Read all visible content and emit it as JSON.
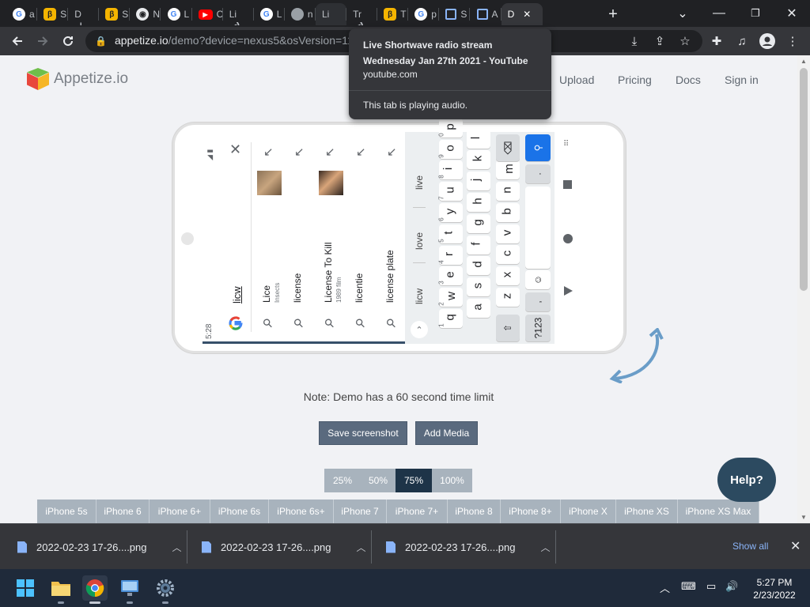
{
  "browser": {
    "tabs": [
      {
        "icon": "google-icon",
        "label": "a"
      },
      {
        "icon": "orange-icon",
        "label": "S"
      },
      {
        "icon": "download-icon",
        "label": "D"
      },
      {
        "icon": "orange-icon",
        "label": "S"
      },
      {
        "icon": "github-icon",
        "label": "N"
      },
      {
        "icon": "google-icon",
        "label": "L"
      },
      {
        "icon": "youtube-icon",
        "label": "C"
      },
      {
        "icon": "audio-icon",
        "label": "Li"
      },
      {
        "icon": "google-icon",
        "label": "L"
      },
      {
        "icon": "globe-icon",
        "label": "n"
      },
      {
        "icon": "none",
        "label": "Li"
      },
      {
        "icon": "audio-icon",
        "label": "Tr"
      },
      {
        "icon": "orange-icon",
        "label": "T"
      },
      {
        "icon": "google-icon",
        "label": "p"
      },
      {
        "icon": "appetize-icon",
        "label": "S"
      },
      {
        "icon": "appetize-icon",
        "label": "A"
      },
      {
        "icon": "none",
        "label": "D",
        "active": true
      }
    ],
    "new_tab": "+",
    "url_host": "appetize.io",
    "url_path": "/demo?device=nexus5&osVersion=11",
    "window_controls": {
      "minimize": "—",
      "restore": "❐",
      "close": "✕",
      "tab_search": "⌄"
    }
  },
  "tooltip": {
    "title_line1": "Live Shortwave radio stream",
    "title_line2": "Wednesday Jan 27th 2021 - YouTube",
    "domain": "youtube.com",
    "status": "This tab is playing audio."
  },
  "site": {
    "logo_text": "Appetize.io",
    "nav": [
      "Upload",
      "Pricing",
      "Docs",
      "Sign in"
    ],
    "note": "Note: Demo has a 60 second time limit",
    "save_screenshot": "Save screenshot",
    "add_media": "Add Media",
    "zoom": [
      {
        "label": "25%",
        "selected": false
      },
      {
        "label": "50%",
        "selected": false
      },
      {
        "label": "75%",
        "selected": true
      },
      {
        "label": "100%",
        "selected": false
      }
    ],
    "devices": [
      "iPhone 5s",
      "iPhone 6",
      "iPhone 6+",
      "iPhone 6s",
      "iPhone 6s+",
      "iPhone 7",
      "iPhone 7+",
      "iPhone 8",
      "iPhone 8+",
      "iPhone X",
      "iPhone XS",
      "iPhone XS Max"
    ],
    "help": "Help?"
  },
  "emulator": {
    "status_time": "5:28",
    "search_query": "licw",
    "suggestions": [
      {
        "title": "Lice",
        "subtitle": "Insects",
        "has_image": true
      },
      {
        "title": "license",
        "subtitle": "",
        "has_image": false
      },
      {
        "title": "License To Kill",
        "subtitle": "1989 film",
        "has_image": true
      },
      {
        "title": "licentie",
        "subtitle": "",
        "has_image": false
      },
      {
        "title": "license plate",
        "subtitle": "",
        "has_image": false
      }
    ],
    "keyboard_suggestions": [
      "licw",
      "love",
      "live"
    ],
    "keyboard_rows": [
      {
        "keys": [
          "q",
          "w",
          "e",
          "r",
          "t",
          "y",
          "u",
          "i",
          "o",
          "p"
        ],
        "hints": [
          "1",
          "2",
          "3",
          "4",
          "5",
          "6",
          "7",
          "8",
          "9",
          "0"
        ]
      },
      {
        "keys": [
          "a",
          "s",
          "d",
          "f",
          "g",
          "h",
          "j",
          "k",
          "l"
        ]
      },
      {
        "keys": [
          "z",
          "x",
          "c",
          "v",
          "b",
          "n",
          "m"
        ]
      }
    ],
    "key_123": "?123",
    "key_comma": ",",
    "key_period": "."
  },
  "downloads": {
    "files": [
      "2022-02-23 17-26....png",
      "2022-02-23 17-26....png",
      "2022-02-23 17-26....png"
    ],
    "show_all": "Show all"
  },
  "taskbar": {
    "apps": [
      "start-icon",
      "file-explorer-icon",
      "chrome-icon",
      "remote-desktop-icon",
      "settings-icon"
    ],
    "time": "5:27 PM",
    "date": "2/23/2022"
  }
}
